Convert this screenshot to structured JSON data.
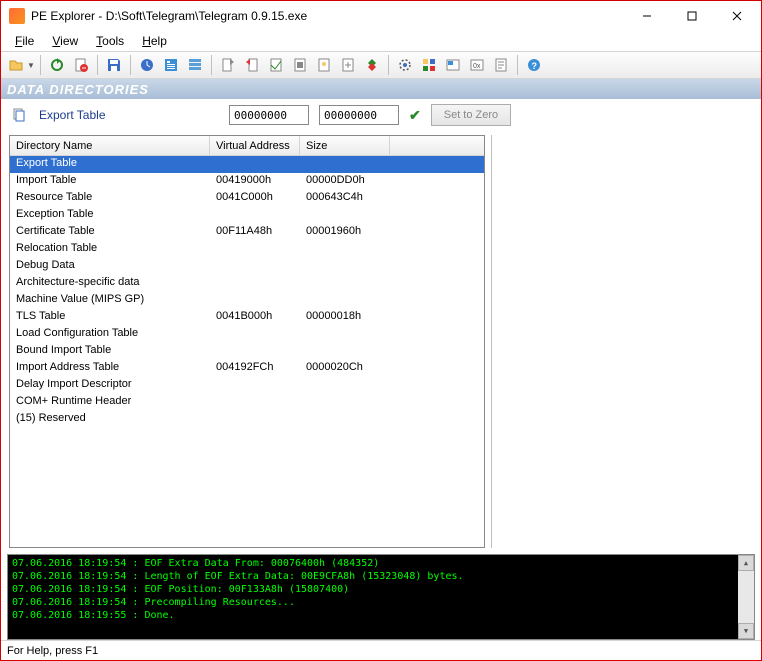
{
  "title": "PE Explorer - D:\\Soft\\Telegram\\Telegram 0.9.15.exe",
  "menus": [
    "File",
    "View",
    "Tools",
    "Help"
  ],
  "section_header": "DATA DIRECTORIES",
  "filter": {
    "label": "Export Table",
    "value1": "00000000",
    "value2": "00000000",
    "zero_btn": "Set to Zero"
  },
  "columns": [
    "Directory Name",
    "Virtual Address",
    "Size"
  ],
  "rows": [
    {
      "name": "Export Table",
      "va": "",
      "size": "",
      "selected": true
    },
    {
      "name": "Import Table",
      "va": "00419000h",
      "size": "00000DD0h"
    },
    {
      "name": "Resource Table",
      "va": "0041C000h",
      "size": "000643C4h"
    },
    {
      "name": "Exception Table",
      "va": "",
      "size": ""
    },
    {
      "name": "Certificate Table",
      "va": "00F11A48h",
      "size": "00001960h"
    },
    {
      "name": "Relocation Table",
      "va": "",
      "size": ""
    },
    {
      "name": "Debug Data",
      "va": "",
      "size": ""
    },
    {
      "name": "Architecture-specific data",
      "va": "",
      "size": ""
    },
    {
      "name": "Machine Value (MIPS GP)",
      "va": "",
      "size": ""
    },
    {
      "name": "TLS Table",
      "va": "0041B000h",
      "size": "00000018h"
    },
    {
      "name": "Load Configuration Table",
      "va": "",
      "size": ""
    },
    {
      "name": "Bound Import Table",
      "va": "",
      "size": ""
    },
    {
      "name": "Import Address Table",
      "va": "004192FCh",
      "size": "0000020Ch"
    },
    {
      "name": "Delay Import Descriptor",
      "va": "",
      "size": ""
    },
    {
      "name": "COM+ Runtime Header",
      "va": "",
      "size": ""
    },
    {
      "name": "(15) Reserved",
      "va": "",
      "size": ""
    }
  ],
  "console": [
    "07.06.2016 18:19:54 : EOF Extra Data From: 00076400h  (484352)",
    "07.06.2016 18:19:54 : Length of EOF Extra Data: 00E9CFA8h  (15323048) bytes.",
    "07.06.2016 18:19:54 : EOF Position: 00F133A8h  (15807400)",
    "07.06.2016 18:19:54 : Precompiling Resources...",
    "07.06.2016 18:19:55 : Done."
  ],
  "status": "For Help, press F1"
}
